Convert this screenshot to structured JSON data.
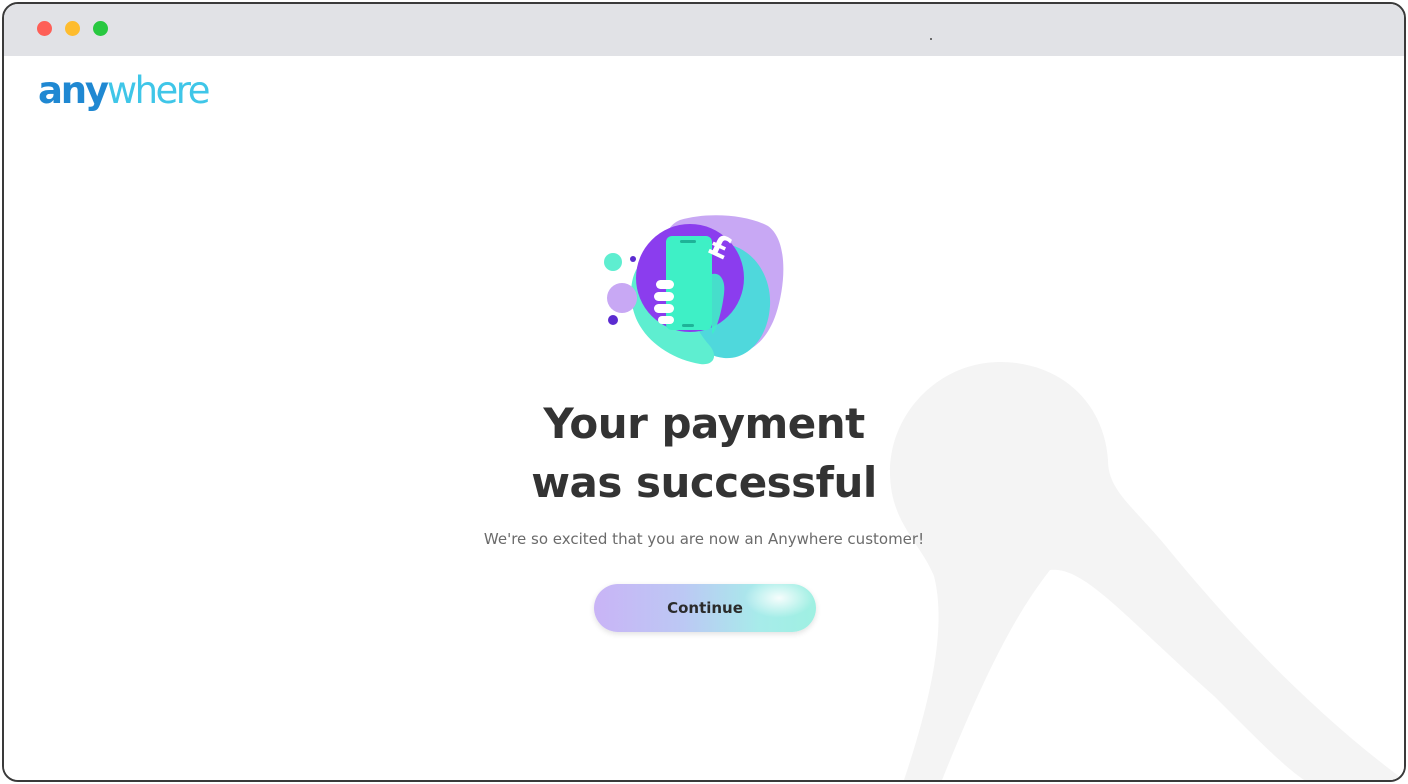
{
  "window": {
    "controls": [
      {
        "name": "close",
        "color": "#fe5f57"
      },
      {
        "name": "minimize",
        "color": "#febc2e"
      },
      {
        "name": "maximize",
        "color": "#28c840"
      }
    ]
  },
  "brand": {
    "logo_part1": "any",
    "logo_part2": "where",
    "colors": {
      "primary_blue": "#1f88d2",
      "light_blue": "#3fc6e8",
      "purple": "#8b3dee",
      "lavender": "#c8a8f4",
      "mint": "#3ef0c6",
      "turquoise": "#4fd8dc"
    }
  },
  "illustration": {
    "icon": "phone-payment-pound-icon",
    "symbol": "£"
  },
  "main": {
    "headline_line1": "Your payment",
    "headline_line2": "was successful",
    "subtext": "We're so excited that you are now an Anywhere customer!",
    "continue_label": "Continue"
  }
}
